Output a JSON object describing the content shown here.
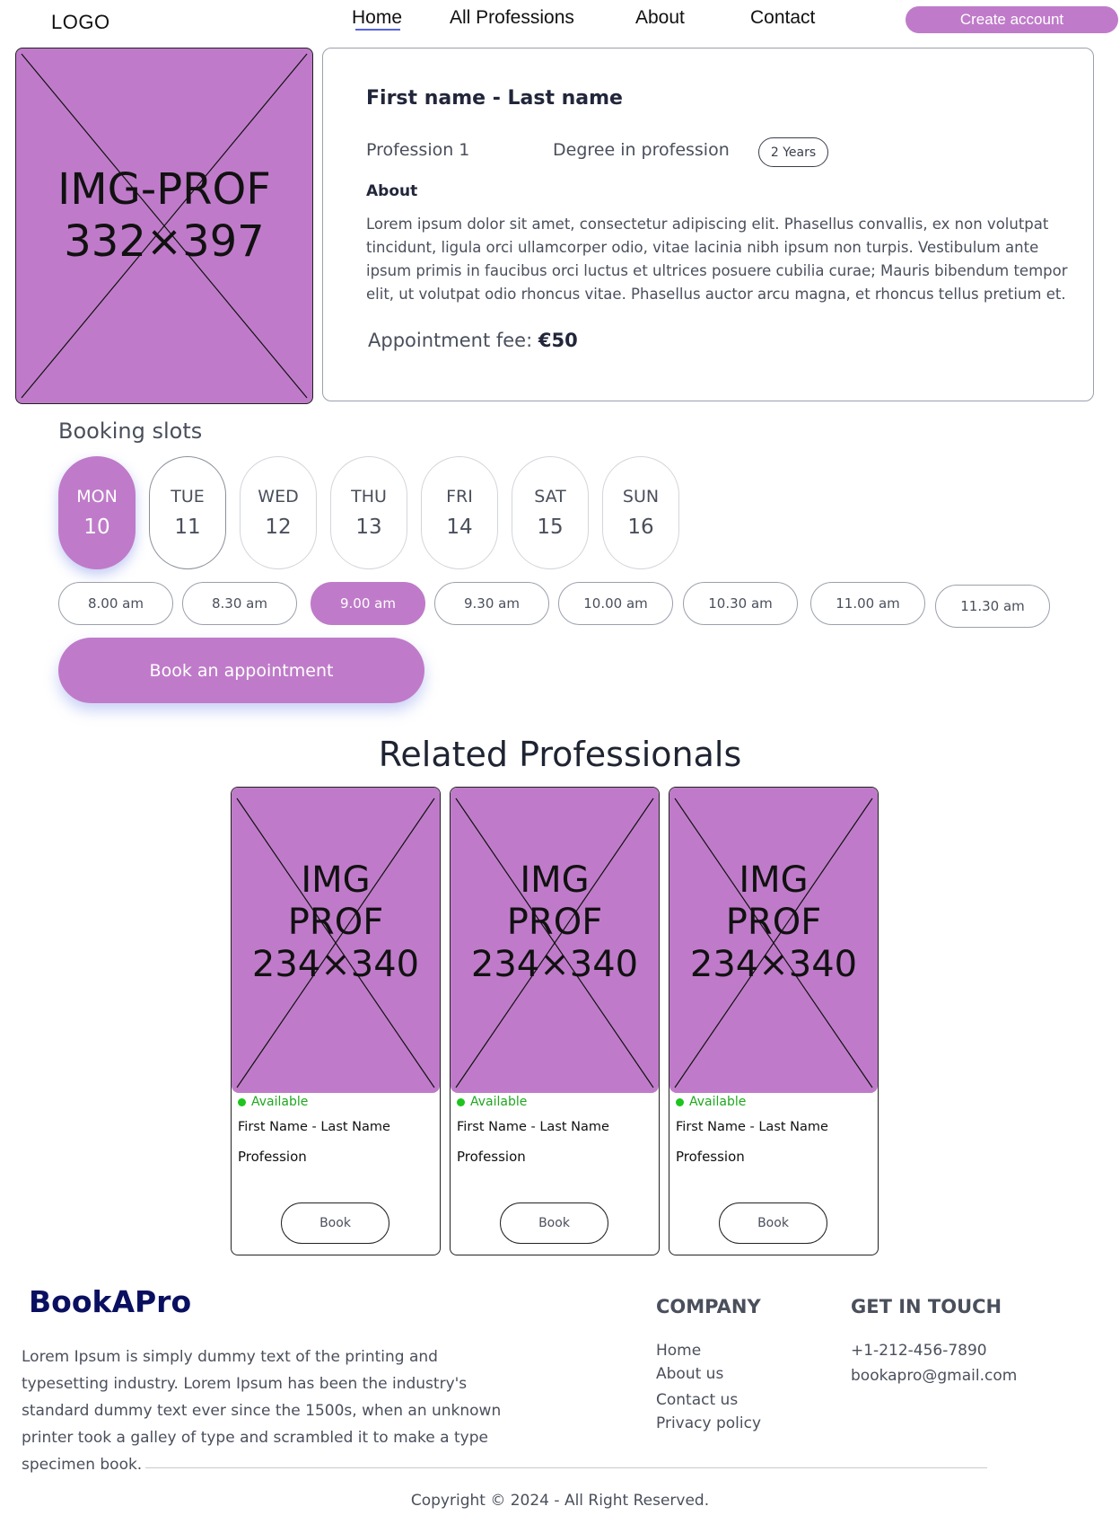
{
  "header": {
    "logo": "LOGO",
    "nav": [
      {
        "label": "Home"
      },
      {
        "label": "All Professions"
      },
      {
        "label": "About"
      },
      {
        "label": "Contact"
      }
    ],
    "create_account": "Create account"
  },
  "profile": {
    "image_label_1": "IMG-PROF",
    "image_label_2": "332×397",
    "name": "First name - Last name",
    "profession": "Profession 1",
    "degree": "Degree in profession",
    "years": "2 Years",
    "about_heading": "About",
    "about_text": "Lorem ipsum dolor sit amet, consectetur adipiscing elit. Phasellus convallis, ex non volutpat tincidunt, ligula orci ullamcorper odio, vitae lacinia nibh ipsum non turpis. Vestibulum ante ipsum primis in faucibus orci luctus et ultrices posuere cubilia curae; Mauris bibendum tempor elit, ut volutpat odio rhoncus vitae. Phasellus auctor arcu magna, et rhoncus tellus pretium et.",
    "fee_label": "Appointment fee:",
    "fee_value": "€50"
  },
  "booking": {
    "title": "Booking slots",
    "days": [
      {
        "name": "MON",
        "date": "10",
        "selected": true
      },
      {
        "name": "TUE",
        "date": "11",
        "selected": false
      },
      {
        "name": "WED",
        "date": "12",
        "selected": false
      },
      {
        "name": "THU",
        "date": "13",
        "selected": false
      },
      {
        "name": "FRI",
        "date": "14",
        "selected": false
      },
      {
        "name": "SAT",
        "date": "15",
        "selected": false
      },
      {
        "name": "SUN",
        "date": "16",
        "selected": false
      }
    ],
    "slots": [
      {
        "time": "8.00 am",
        "selected": false
      },
      {
        "time": "8.30 am",
        "selected": false
      },
      {
        "time": "9.00 am",
        "selected": true
      },
      {
        "time": "9.30 am",
        "selected": false
      },
      {
        "time": "10.00 am",
        "selected": false
      },
      {
        "time": "10.30 am",
        "selected": false
      },
      {
        "time": "11.00 am",
        "selected": false
      },
      {
        "time": "11.30 am",
        "selected": false
      }
    ],
    "book_button": "Book an appointment"
  },
  "related": {
    "title": "Related Professionals",
    "cards": [
      {
        "img_1": "IMG",
        "img_2": "PROF",
        "img_3": "234×340",
        "status": "Available",
        "name": "First Name - Last Name",
        "profession": "Profession",
        "book": "Book"
      },
      {
        "img_1": "IMG",
        "img_2": "PROF",
        "img_3": "234×340",
        "status": "Available",
        "name": "First Name - Last Name",
        "profession": "Profession",
        "book": "Book"
      },
      {
        "img_1": "IMG",
        "img_2": "PROF",
        "img_3": "234×340",
        "status": "Available",
        "name": "First Name - Last Name",
        "profession": "Profession",
        "book": "Book"
      }
    ]
  },
  "footer": {
    "brand": "BookAPro",
    "description": "Lorem Ipsum is simply dummy text of the printing and typesetting industry. Lorem Ipsum has been the industry's standard dummy text ever since the 1500s, when an unknown printer took a galley of type and scrambled it to make a type specimen book.",
    "company_heading": "COMPANY",
    "company_links": [
      "Home",
      "About us",
      "Contact us",
      "Privacy policy"
    ],
    "contact_heading": "GET IN TOUCH",
    "phone": "+1-212-456-7890",
    "email": "bookapro@gmail.com",
    "copyright": "Copyright © 2024 - All Right Reserved."
  },
  "colors": {
    "accent": "#bf7bc9",
    "brand": "#0a1060",
    "available": "#1fa81f",
    "nav_underline": "#5562e0"
  }
}
